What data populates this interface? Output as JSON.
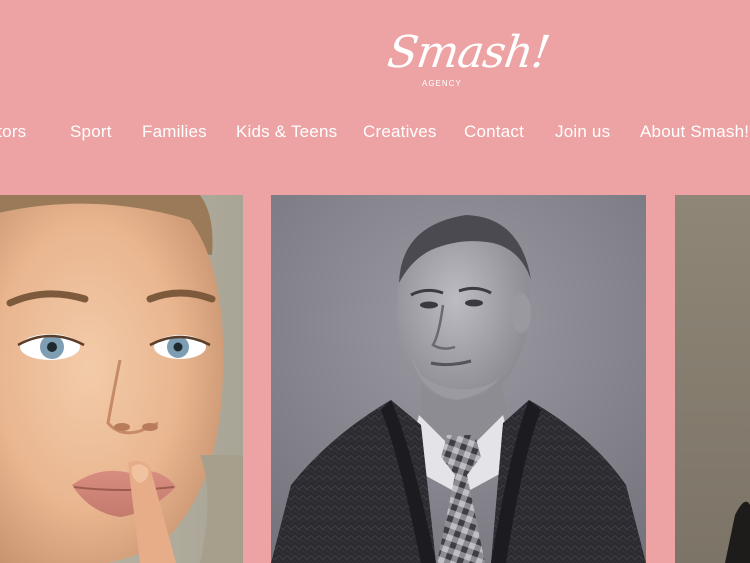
{
  "brand": {
    "logo_text": "Smash!",
    "logo_subtext": "AGENCY"
  },
  "nav": {
    "items": [
      {
        "label": "Actors"
      },
      {
        "label": "Sport"
      },
      {
        "label": "Families"
      },
      {
        "label": "Kids & Teens"
      },
      {
        "label": "Creatives"
      },
      {
        "label": "Contact"
      },
      {
        "label": "Join us"
      },
      {
        "label": "About Smash!"
      }
    ]
  },
  "colors": {
    "background": "#eda2a3",
    "text": "#ffffff"
  }
}
